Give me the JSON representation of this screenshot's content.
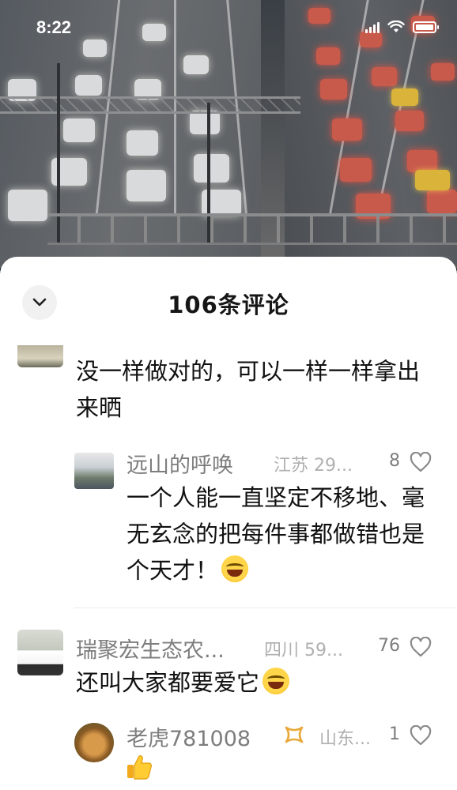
{
  "status_bar": {
    "time": "8:22"
  },
  "sheet": {
    "title": "106条评论"
  },
  "comments": [
    {
      "text": "没一样做对的，可以一样一样拿出来晒"
    },
    {
      "name": "远山的呼唤",
      "location": "江苏 29...",
      "likes": "8",
      "text": "一个人能一直坚定不移地、毫无玄念的把每件事都做错也是个天才！"
    },
    {
      "name": "瑞聚宏生态农...",
      "location": "四川 59...",
      "likes": "76",
      "text": "还叫大家都要爱它"
    },
    {
      "name": "老虎781008",
      "location": "山东...",
      "likes": "1"
    }
  ],
  "icons": {
    "collapse": "chevron-down-icon",
    "like": "heart-outline-icon",
    "badge": "ribbon-badge-icon",
    "laugh": "laughing-tears-emoji",
    "thumb": "thumbs-up-emoji"
  },
  "colors": {
    "sheet_bg": "#ffffff",
    "name_gray": "#7d7d7d",
    "location_gray": "#b0b0b0",
    "badge_gold": "#e8a83a"
  }
}
